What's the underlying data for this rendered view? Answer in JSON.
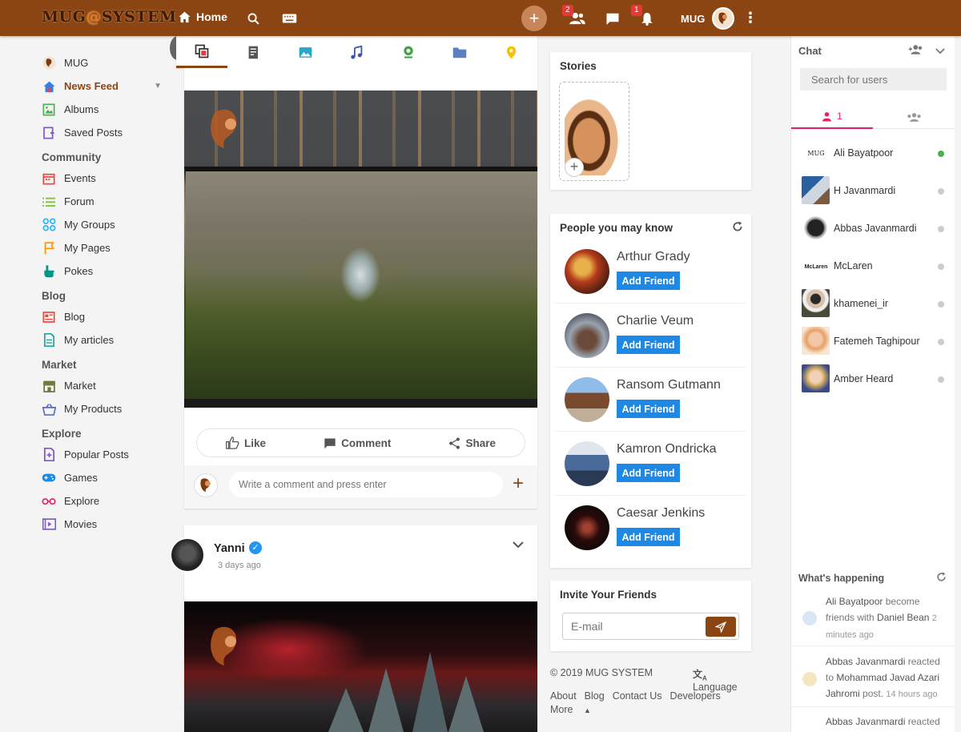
{
  "header": {
    "logo": "MUG",
    "logo_swirl": "@",
    "logo_rest": "SYSTEM",
    "home_label": "Home",
    "friend_requests_count": "2",
    "notifications_count": "1",
    "username": "MUG"
  },
  "sidebar": {
    "items": [
      {
        "label": "MUG"
      },
      {
        "label": "News Feed"
      },
      {
        "label": "Albums"
      },
      {
        "label": "Saved Posts"
      }
    ],
    "community": {
      "title": "Community",
      "items": [
        "Events",
        "Forum",
        "My Groups",
        "My Pages",
        "Pokes"
      ]
    },
    "blog": {
      "title": "Blog",
      "items": [
        "Blog",
        "My articles"
      ]
    },
    "market": {
      "title": "Market",
      "items": [
        "Market",
        "My Products"
      ]
    },
    "explore": {
      "title": "Explore",
      "items": [
        "Popular Posts",
        "Games",
        "Explore",
        "Movies"
      ]
    }
  },
  "feed": {
    "post1": {
      "like": "Like",
      "comment": "Comment",
      "share": "Share",
      "comment_placeholder": "Write a comment and press enter"
    },
    "post2": {
      "author": "Yanni",
      "time": "3 days ago"
    }
  },
  "stories": {
    "title": "Stories"
  },
  "pymk": {
    "title": "People you may know",
    "add_label": "Add Friend",
    "people": [
      "Arthur Grady",
      "Charlie Veum",
      "Ransom Gutmann",
      "Kamron Ondricka",
      "Caesar Jenkins"
    ]
  },
  "invite": {
    "title": "Invite Your Friends",
    "placeholder": "E-mail"
  },
  "footer": {
    "copyright": "© 2019 MUG SYSTEM",
    "language": "Language",
    "links": [
      "About",
      "Blog",
      "Contact Us",
      "Developers"
    ],
    "more": "More"
  },
  "chat": {
    "title": "Chat",
    "search_placeholder": "Search for users",
    "online_count": "1",
    "contacts": [
      {
        "name": "Ali Bayatpoor",
        "online": true
      },
      {
        "name": "H Javanmardi",
        "online": false
      },
      {
        "name": "Abbas Javanmardi",
        "online": false
      },
      {
        "name": "McLaren",
        "online": false
      },
      {
        "name": "khamenei_ir",
        "online": false
      },
      {
        "name": "Fatemeh Taghipour",
        "online": false
      },
      {
        "name": "Amber Heard",
        "online": false
      }
    ],
    "happening_title": "What's happening",
    "activities": [
      {
        "actor": "Ali Bayatpoor",
        "text": "become friends with",
        "target": "Daniel Bean",
        "time": "2 minutes ago"
      },
      {
        "actor": "Abbas Javanmardi",
        "text": "reacted to",
        "target": "Mohammad Javad Azari Jahromi",
        "suffix": "post.",
        "time": "14 hours ago"
      },
      {
        "actor": "Abbas Javanmardi",
        "text": "reacted",
        "target": "",
        "time": ""
      }
    ]
  },
  "colors": {
    "brand": "#8b4513",
    "addfriend": "#1e88e5",
    "online": "#4caf50",
    "badge": "#e53935"
  }
}
